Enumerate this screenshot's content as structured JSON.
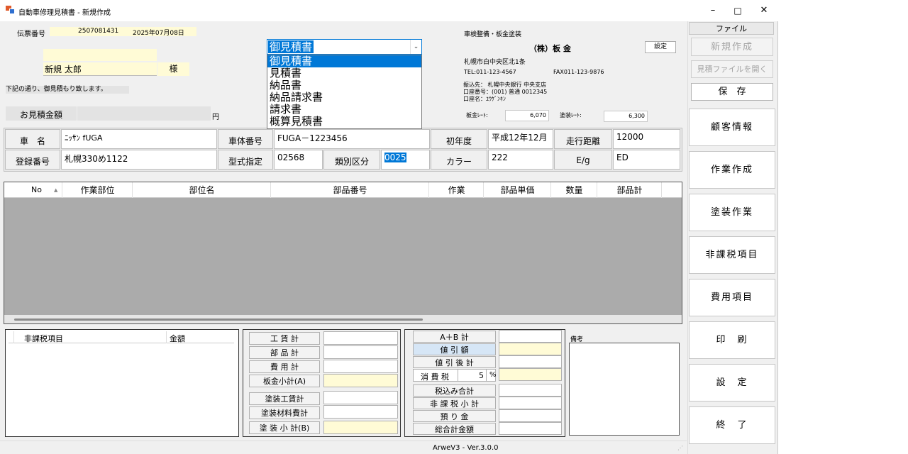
{
  "window": {
    "title": "自動車修理見積書  -  新規作成",
    "min_glyph": "–",
    "max_glyph": "□",
    "close_glyph": "✕"
  },
  "header": {
    "voucher_label": "伝票番号",
    "voucher_number": "2507081431",
    "voucher_date": "2025年07月08日",
    "customer_name": "新規 太郎",
    "honorific": "様",
    "intro_text": "下記の通り、御見積もり致します。",
    "estimate_amount_label": "お見積金額",
    "yen_label": "円"
  },
  "doc_type": {
    "selected": "御見積書",
    "options": [
      "御見積書",
      "見積書",
      "納品書",
      "納品請求書",
      "請求書",
      "概算見積書"
    ],
    "highlighted_index": 0
  },
  "company": {
    "business": "車検整備・板金塗装",
    "name": "（株）板  金",
    "settings_button": "設定",
    "address": "札幌市白中央区北1条",
    "tel": "TEL:011-123-4567",
    "fax": "FAX011-123-9876",
    "bank_line1": "振込先： 札幌中央銀行 中央支店",
    "bank_line2": "口座番号：(001) 普通 0012345",
    "bank_line3": "口座名：ﾕｳｹﾞﾝｷﾝ",
    "sheet_rate_label": "板金ﾚｰﾄ:",
    "sheet_rate": "6,070",
    "paint_rate_label": "塗装ﾚｰﾄ:",
    "paint_rate": "6,300"
  },
  "vehicle": {
    "car_name_label": "車　名",
    "car_name": "ﾆｯｻﾝ fUGA",
    "body_no_label": "車体番号",
    "body_no": "FUGA－1223456",
    "first_year_label": "初年度",
    "first_year": "平成12年12月",
    "mileage_label": "走行距離",
    "mileage": "12000",
    "reg_no_label": "登録番号",
    "reg_no": "札幌330め1122",
    "model_label": "型式指定",
    "model": "02568",
    "class_label": "類別区分",
    "class": "0025",
    "color_label": "カラー",
    "color": "222",
    "eg_label": "E/g",
    "eg": "ED"
  },
  "work_table": {
    "columns": [
      "No",
      "作業部位",
      "部位名",
      "部品番号",
      "作業",
      "部品単価",
      "数量",
      "部品計"
    ]
  },
  "tax_free": {
    "col1": "非課税項目",
    "col2": "金額"
  },
  "subtotals": {
    "labor": "工 賃 計",
    "parts": "部 品 計",
    "expense": "費 用 計",
    "sheet_sub": "板金小計(A)",
    "paint_labor": "塗装工賃計",
    "paint_material": "塗装材料費計",
    "paint_sub": "塗 装 小 計(B)"
  },
  "totals": {
    "ab": "A＋B 計",
    "discount": "値 引 額",
    "after_discount": "値 引 後 計",
    "tax_label": "消 費 税",
    "tax_rate": "5",
    "percent": "%",
    "with_tax": "税込み合計",
    "nontax_sub": "非 課 税 小 計",
    "deposit": "預 り 金",
    "grand_total": "総合計金額"
  },
  "memo_label": "備考",
  "sidebar": {
    "file_label": "ファイル",
    "new": "新規作成",
    "open": "見積ファイルを開く",
    "save": "保　存",
    "items": [
      "顧客情報",
      "作業作成",
      "塗装作業",
      "非課税項目",
      "費用項目",
      "印　刷",
      "設　定",
      "終　了"
    ]
  },
  "status": {
    "version": "ArweV3 - Ver.3.0.0"
  }
}
